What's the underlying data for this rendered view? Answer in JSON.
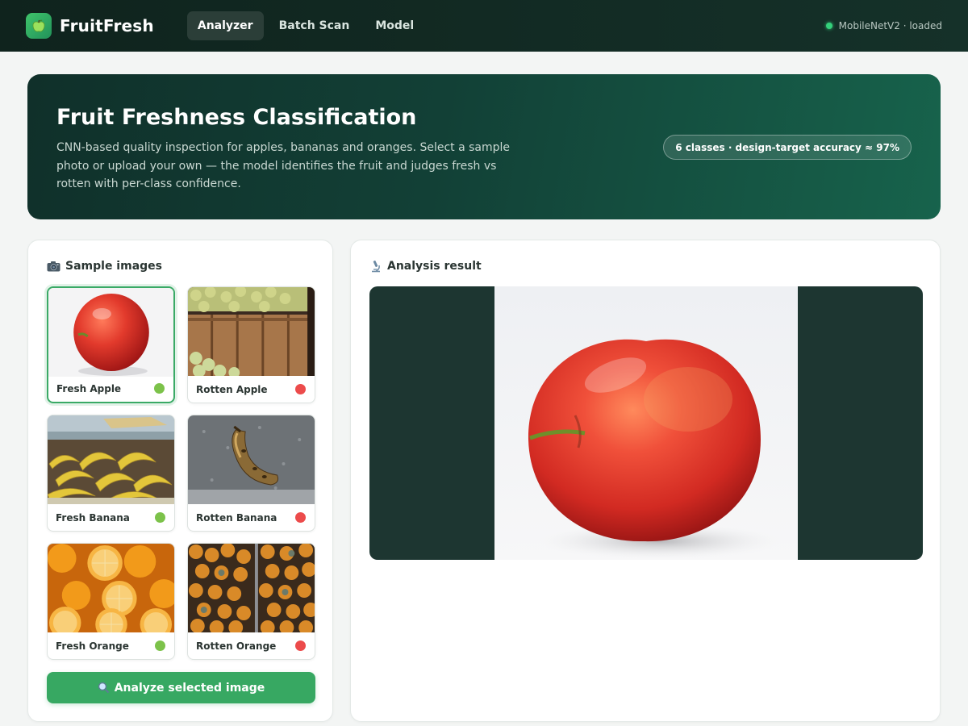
{
  "app": {
    "name": "FruitFresh",
    "logo_icon": "apple-icon"
  },
  "nav": {
    "items": [
      {
        "label": "Analyzer",
        "active": true
      },
      {
        "label": "Batch Scan",
        "active": false
      },
      {
        "label": "Model",
        "active": false
      }
    ]
  },
  "status": {
    "text": "MobileNetV2 · loaded",
    "color": "#34d17b"
  },
  "hero": {
    "title": "Fruit Freshness Classification",
    "description": "CNN-based quality inspection for apples, bananas and oranges. Select a sample photo or upload your own — the model identifies the fruit and judges fresh vs rotten with per-class confidence.",
    "badge": "6 classes · design-target accuracy ≈ 97%"
  },
  "samples": {
    "title": "Sample images",
    "title_icon": "camera-icon",
    "items": [
      {
        "label": "Fresh Apple",
        "status": "fresh",
        "dot_color": "#7cc24a",
        "selected": true
      },
      {
        "label": "Rotten Apple",
        "status": "rotten",
        "dot_color": "#ec4b4b",
        "selected": false
      },
      {
        "label": "Fresh Banana",
        "status": "fresh",
        "dot_color": "#7cc24a",
        "selected": false
      },
      {
        "label": "Rotten Banana",
        "status": "rotten",
        "dot_color": "#ec4b4b",
        "selected": false
      },
      {
        "label": "Fresh Orange",
        "status": "fresh",
        "dot_color": "#7cc24a",
        "selected": false
      },
      {
        "label": "Rotten Orange",
        "status": "rotten",
        "dot_color": "#ec4b4b",
        "selected": false
      }
    ],
    "analyze_label": "Analyze selected image",
    "analyze_icon": "magnifier-icon"
  },
  "result": {
    "title": "Analysis result",
    "title_icon": "microscope-icon"
  },
  "colors": {
    "accent": "#37a862",
    "header_bg": "#0f231d",
    "hero_bg": "#124036"
  }
}
